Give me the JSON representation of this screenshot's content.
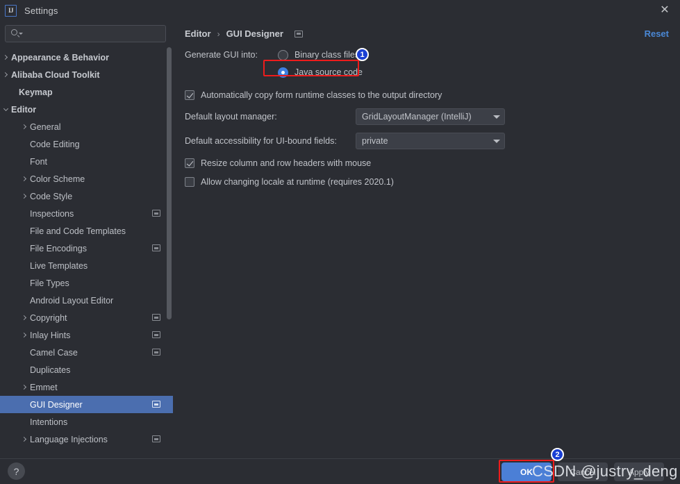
{
  "window": {
    "title": "Settings",
    "app_icon": "IJ",
    "close_icon": "✕"
  },
  "search": {
    "value": "",
    "placeholder": ""
  },
  "sidebar": {
    "items": [
      {
        "label": "Appearance & Behavior",
        "indent": 16,
        "arrow": "right",
        "bold": true,
        "project_icon": false,
        "selected": false
      },
      {
        "label": "Alibaba Cloud Toolkit",
        "indent": 16,
        "arrow": "right",
        "bold": true,
        "project_icon": false,
        "selected": false
      },
      {
        "label": "Keymap",
        "indent": 27,
        "arrow": "none",
        "bold": true,
        "project_icon": false,
        "selected": false
      },
      {
        "label": "Editor",
        "indent": 16,
        "arrow": "down",
        "bold": true,
        "project_icon": false,
        "selected": false
      },
      {
        "label": "General",
        "indent": 43,
        "arrow": "right",
        "bold": false,
        "project_icon": false,
        "selected": false
      },
      {
        "label": "Code Editing",
        "indent": 43,
        "arrow": "none",
        "bold": false,
        "project_icon": false,
        "selected": false
      },
      {
        "label": "Font",
        "indent": 43,
        "arrow": "none",
        "bold": false,
        "project_icon": false,
        "selected": false
      },
      {
        "label": "Color Scheme",
        "indent": 43,
        "arrow": "right",
        "bold": false,
        "project_icon": false,
        "selected": false
      },
      {
        "label": "Code Style",
        "indent": 43,
        "arrow": "right",
        "bold": false,
        "project_icon": false,
        "selected": false
      },
      {
        "label": "Inspections",
        "indent": 43,
        "arrow": "none",
        "bold": false,
        "project_icon": true,
        "selected": false
      },
      {
        "label": "File and Code Templates",
        "indent": 43,
        "arrow": "none",
        "bold": false,
        "project_icon": false,
        "selected": false
      },
      {
        "label": "File Encodings",
        "indent": 43,
        "arrow": "none",
        "bold": false,
        "project_icon": true,
        "selected": false
      },
      {
        "label": "Live Templates",
        "indent": 43,
        "arrow": "none",
        "bold": false,
        "project_icon": false,
        "selected": false
      },
      {
        "label": "File Types",
        "indent": 43,
        "arrow": "none",
        "bold": false,
        "project_icon": false,
        "selected": false
      },
      {
        "label": "Android Layout Editor",
        "indent": 43,
        "arrow": "none",
        "bold": false,
        "project_icon": false,
        "selected": false
      },
      {
        "label": "Copyright",
        "indent": 43,
        "arrow": "right",
        "bold": false,
        "project_icon": true,
        "selected": false
      },
      {
        "label": "Inlay Hints",
        "indent": 43,
        "arrow": "right",
        "bold": false,
        "project_icon": true,
        "selected": false
      },
      {
        "label": "Camel Case",
        "indent": 43,
        "arrow": "none",
        "bold": false,
        "project_icon": true,
        "selected": false
      },
      {
        "label": "Duplicates",
        "indent": 43,
        "arrow": "none",
        "bold": false,
        "project_icon": false,
        "selected": false
      },
      {
        "label": "Emmet",
        "indent": 43,
        "arrow": "right",
        "bold": false,
        "project_icon": false,
        "selected": false
      },
      {
        "label": "GUI Designer",
        "indent": 43,
        "arrow": "none",
        "bold": false,
        "project_icon": true,
        "selected": true
      },
      {
        "label": "Intentions",
        "indent": 43,
        "arrow": "none",
        "bold": false,
        "project_icon": false,
        "selected": false
      },
      {
        "label": "Language Injections",
        "indent": 43,
        "arrow": "right",
        "bold": false,
        "project_icon": true,
        "selected": false
      }
    ]
  },
  "header": {
    "breadcrumb_root": "Editor",
    "breadcrumb_sep": "›",
    "breadcrumb_leaf": "GUI Designer",
    "reset_label": "Reset"
  },
  "settings": {
    "generate_label": "Generate GUI into:",
    "radio_binary_label": "Binary class files",
    "radio_binary_checked": false,
    "radio_java_label": "Java source code",
    "radio_java_checked": true,
    "auto_copy_label": "Automatically copy form runtime classes to the output directory",
    "auto_copy_checked": true,
    "layout_manager_label": "Default layout manager:",
    "layout_manager_value": "GridLayoutManager (IntelliJ)",
    "accessibility_label": "Default accessibility for UI-bound fields:",
    "accessibility_value": "private",
    "resize_headers_label": "Resize column and row headers with mouse",
    "resize_headers_checked": true,
    "allow_locale_label": "Allow changing locale at runtime (requires 2020.1)",
    "allow_locale_checked": false
  },
  "footer": {
    "help_label": "?",
    "ok_label": "OK",
    "cancel_label": "Cancel",
    "apply_label": "Apply"
  },
  "annotations": {
    "badge_1": "1",
    "badge_2": "2",
    "watermark": "CSDN @justry_deng",
    "highlight_color": "#ee1c1c",
    "badge_color": "#1a3fd4",
    "selection_color": "#4b6eaf",
    "accent_color": "#4a88d6"
  }
}
